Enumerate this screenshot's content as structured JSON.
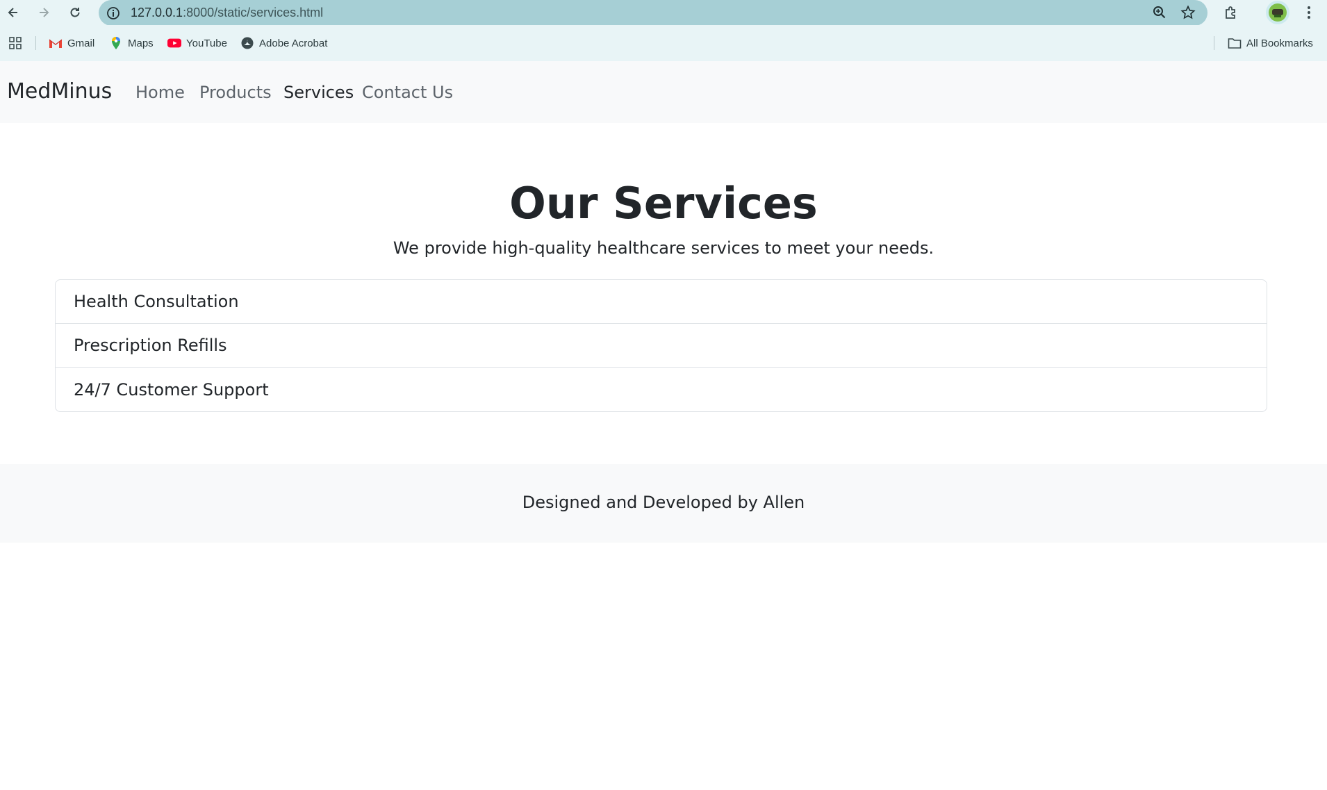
{
  "browser": {
    "url_host": "127.0.0.1",
    "url_path": ":8000/static/services.html",
    "icons": {
      "back": "back-arrow-icon",
      "forward": "forward-arrow-icon",
      "reload": "reload-icon",
      "site_info": "info-icon",
      "zoom": "zoom-icon",
      "bookmark": "star-icon",
      "extensions": "puzzle-icon",
      "profile": "avatar",
      "menu": "kebab-menu-icon"
    },
    "bookmarks": [
      {
        "label": "Gmail",
        "icon": "gmail-icon"
      },
      {
        "label": "Maps",
        "icon": "maps-icon"
      },
      {
        "label": "YouTube",
        "icon": "youtube-icon"
      },
      {
        "label": "Adobe Acrobat",
        "icon": "acrobat-icon"
      }
    ],
    "all_bookmarks": "All Bookmarks"
  },
  "navbar": {
    "brand": "MedMinus",
    "links": [
      {
        "label": "Home",
        "active": false
      },
      {
        "label": "Products",
        "active": false
      },
      {
        "label": "Services",
        "active": true
      },
      {
        "label": "Contact Us",
        "active": false
      }
    ]
  },
  "main": {
    "title": "Our Services",
    "subtitle": "We provide high-quality healthcare services to meet your needs.",
    "services": [
      "Health Consultation",
      "Prescription Refills",
      "24/7 Customer Support"
    ]
  },
  "footer": {
    "text": "Designed and Developed by Allen"
  },
  "colors": {
    "chrome_bg": "#e8f4f6",
    "omnibox_bg": "#a6cfd5",
    "navbar_bg": "#f8f9fa",
    "text": "#212529",
    "muted_link": "#5c636a"
  }
}
